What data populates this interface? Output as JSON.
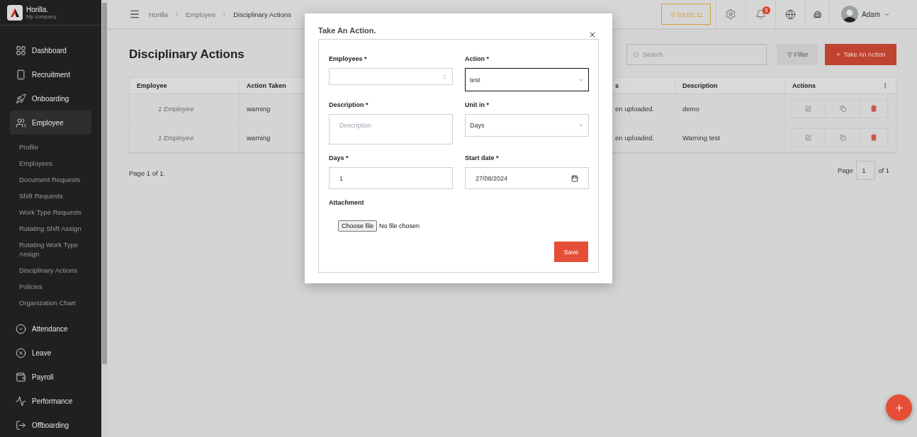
{
  "brand": {
    "name": "Horilla.",
    "company": "My company"
  },
  "sidebar": {
    "items": [
      {
        "label": "Dashboard",
        "selected": false
      },
      {
        "label": "Recruitment",
        "selected": false
      },
      {
        "label": "Onboarding",
        "selected": false
      },
      {
        "label": "Employee",
        "selected": true,
        "children": [
          {
            "label": "Profile"
          },
          {
            "label": "Employees"
          },
          {
            "label": "Document Requests"
          },
          {
            "label": "Shift Requests"
          },
          {
            "label": "Work Type Requests"
          },
          {
            "label": "Rotating Shift Assign"
          },
          {
            "label": "Rotating Work Type Assign"
          },
          {
            "label": "Disciplinary Actions"
          },
          {
            "label": "Policies"
          },
          {
            "label": "Organization Chart"
          }
        ]
      },
      {
        "label": "Attendance",
        "selected": false
      },
      {
        "label": "Leave",
        "selected": false
      },
      {
        "label": "Payroll",
        "selected": false
      },
      {
        "label": "Performance",
        "selected": false
      },
      {
        "label": "Offboarding",
        "selected": false
      }
    ]
  },
  "breadcrumb": [
    "Horilla",
    "Employee",
    "Disciplinary Actions"
  ],
  "header": {
    "timer": "03:02:11",
    "notifications": "5",
    "user": "Adam"
  },
  "page": {
    "title": "Disciplinary Actions",
    "search": {
      "placeholder": "Search"
    },
    "filter": "Filter",
    "add": "Take An Action"
  },
  "table": {
    "columns": [
      "Employee",
      "Action Taken",
      "s",
      "Description",
      "Actions"
    ],
    "rows": [
      {
        "employee": "1 Employee",
        "action": "warning",
        "column_3": "en uploaded.",
        "description": "demo"
      },
      {
        "employee": "1 Employee",
        "action": "warning",
        "column_3": "en uploaded.",
        "description": "Warning test"
      }
    ]
  },
  "pagination": {
    "summary": "Page 1 of 1.",
    "label": "Page",
    "value": "1",
    "total": "of 1"
  },
  "modal": {
    "title": "Take An Action.",
    "fields": [
      {
        "kind": "multiselect",
        "label": "Employees *",
        "focused": false
      },
      {
        "kind": "select",
        "label": "Action *",
        "value": "test",
        "focused": true
      },
      {
        "kind": "textarea",
        "label": "Description *",
        "placeholder": "Description",
        "focused": false
      },
      {
        "kind": "select",
        "label": "Unit in *",
        "value": "Days",
        "focused": false
      },
      {
        "kind": "text",
        "label": "Days *",
        "value": "1",
        "focused": false
      },
      {
        "kind": "date",
        "label": "Start date *",
        "value": "27/08/2024",
        "focused": false
      },
      {
        "kind": "file",
        "label": "Attachment",
        "button": "Choose file",
        "value": "No file chosen"
      }
    ],
    "save": "Save"
  }
}
